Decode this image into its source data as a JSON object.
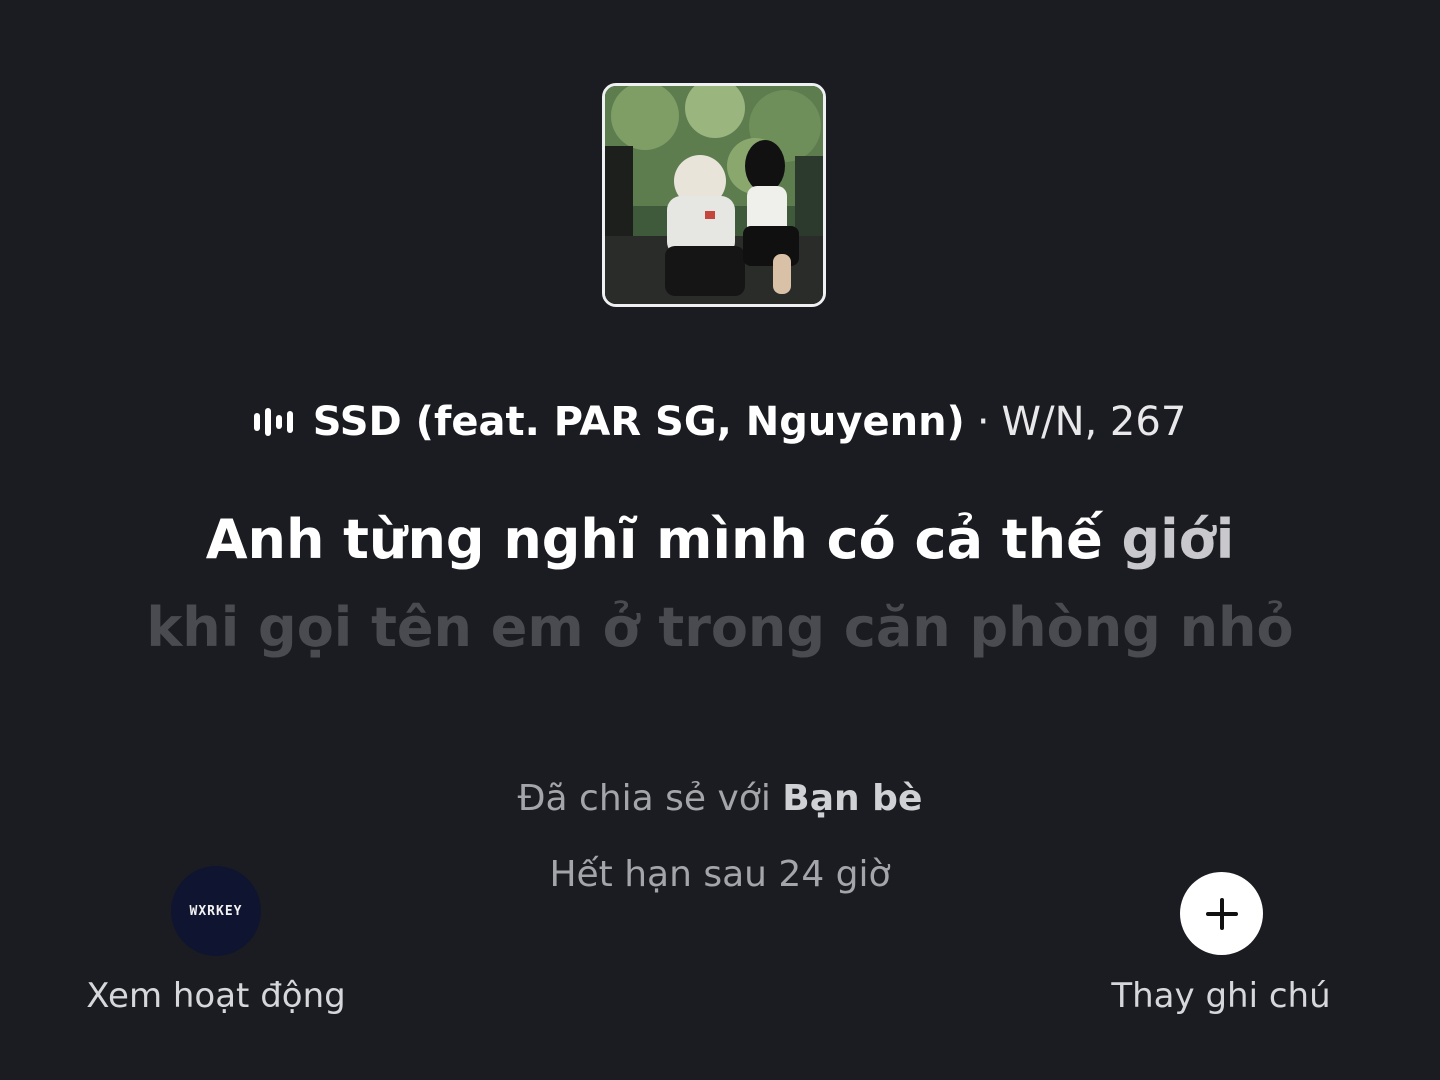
{
  "now_playing": {
    "icon": "equalizer-icon",
    "title": "SSD (feat. PAR SG, Nguyenn)",
    "separator": "·",
    "artist": "W/N, 267"
  },
  "lyrics": {
    "current_highlighted": "Anh từng nghĩ mình có cả thế",
    "current_pending": "giới",
    "next": "khi gọi tên em ở trong căn phòng nhỏ"
  },
  "sharing": {
    "shared_prefix": "Đã chia sẻ với",
    "shared_audience": "Bạn bè",
    "expiry": "Hết hạn sau 24 giờ"
  },
  "left_action": {
    "avatar_text": "WXRKEY",
    "label": "Xem hoạt động"
  },
  "right_action": {
    "icon": "plus-icon",
    "label": "Thay ghi chú"
  }
}
